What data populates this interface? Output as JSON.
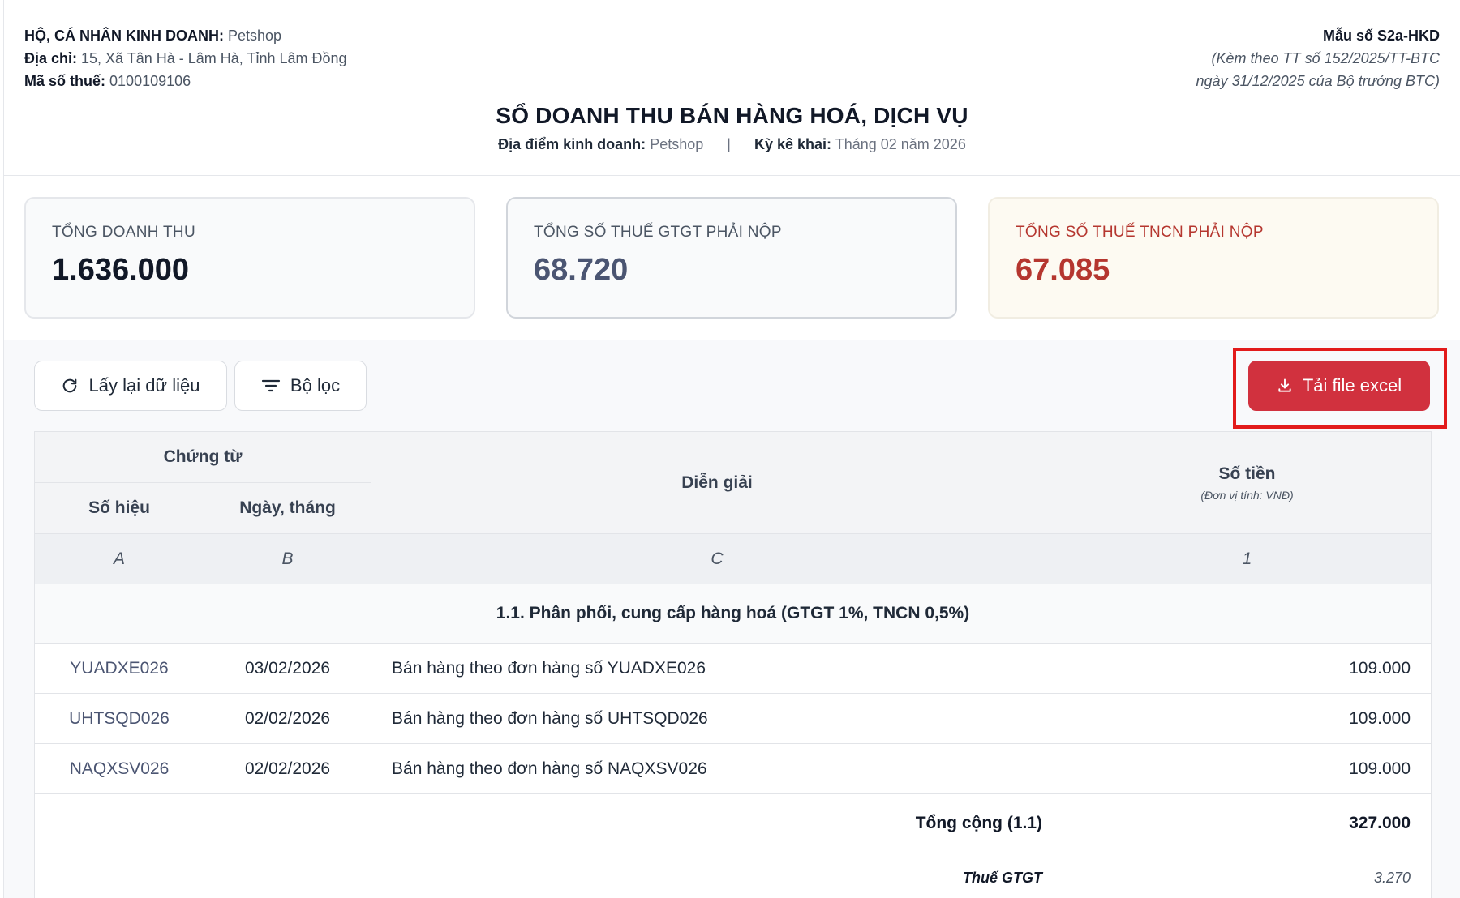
{
  "header": {
    "business_label": "HỘ, CÁ NHÂN KINH DOANH:",
    "business_name": "Petshop",
    "address_label": "Địa chỉ:",
    "address_value": "15, Xã Tân Hà - Lâm Hà, Tỉnh Lâm Đồng",
    "tax_code_label": "Mã số thuế:",
    "tax_code_value": "0100109106",
    "form_number": "Mẫu số S2a-HKD",
    "form_note_line1": "(Kèm theo TT số 152/2025/TT-BTC",
    "form_note_line2": "ngày 31/12/2025 của Bộ trưởng BTC)",
    "report_title": "SỔ DOANH THU BÁN HÀNG HOÁ, DỊCH VỤ",
    "location_label": "Địa điểm kinh doanh:",
    "location_value": "Petshop",
    "separator": "|",
    "period_label": "Kỳ kê khai:",
    "period_value": "Tháng 02 năm 2026"
  },
  "summary": {
    "revenue_label": "TỔNG DOANH THU",
    "revenue_value": "1.636.000",
    "vat_label": "TỔNG SỐ THUẾ GTGT PHẢI NỘP",
    "vat_value": "68.720",
    "pit_label": "TỔNG SỐ THUẾ TNCN PHẢI NỘP",
    "pit_value": "67.085"
  },
  "toolbar": {
    "refresh_label": "Lấy lại dữ liệu",
    "filter_label": "Bộ lọc",
    "export_label": "Tải file excel",
    "refresh_icon": "refresh-icon",
    "filter_icon": "filter-icon",
    "export_icon": "download-icon",
    "export_color": "#d1313e",
    "highlight_color": "#e21b1b"
  },
  "table": {
    "headers": {
      "voucher": "Chứng từ",
      "doc_no": "Số hiệu",
      "doc_date": "Ngày, tháng",
      "description": "Diễn giải",
      "amount": "Số tiền",
      "amount_unit": "(Đơn vị tính: VNĐ)"
    },
    "letters": {
      "a": "A",
      "b": "B",
      "c": "C",
      "d": "1"
    },
    "group_title": "1.1. Phân phối, cung cấp hàng hoá (GTGT 1%, TNCN 0,5%)",
    "rows": [
      {
        "doc_no": "YUADXE026",
        "date": "03/02/2026",
        "description": "Bán hàng theo đơn hàng số YUADXE026",
        "amount": "109.000"
      },
      {
        "doc_no": "UHTSQD026",
        "date": "02/02/2026",
        "description": "Bán hàng theo đơn hàng số UHTSQD026",
        "amount": "109.000"
      },
      {
        "doc_no": "NAQXSV026",
        "date": "02/02/2026",
        "description": "Bán hàng theo đơn hàng số NAQXSV026",
        "amount": "109.000"
      }
    ],
    "total_label": "Tổng cộng (1.1)",
    "total_value": "327.000",
    "vat_label": "Thuế GTGT",
    "vat_value": "3.270"
  }
}
